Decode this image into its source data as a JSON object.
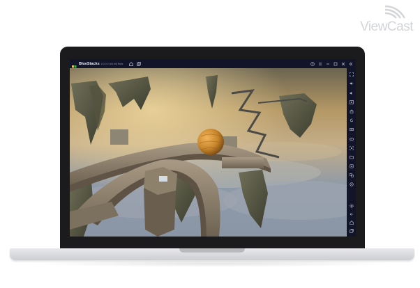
{
  "watermark": {
    "text": "ViewCast"
  },
  "titlebar": {
    "app_name": "BlueStacks",
    "version": "5.0.0.0 (64-bit) Beta",
    "left_icons": [
      "home-icon",
      "multi-instance-icon"
    ],
    "right_icons": [
      "help-icon",
      "menu-icon",
      "minimize-icon",
      "maximize-icon",
      "close-icon",
      "collapse-sidebar-icon"
    ]
  },
  "sidebar": {
    "top_icons": [
      "fullscreen-icon",
      "volume-up-icon",
      "volume-down-icon",
      "video-icon",
      "lock-cursor-icon",
      "rotate-icon",
      "keyboard-controls-icon",
      "gamepad-icon",
      "screenshot-icon",
      "folder-icon",
      "install-apk-icon",
      "multi-instance-sync-icon",
      "location-icon"
    ],
    "bottom_icons": [
      "settings-icon",
      "back-icon",
      "home-icon",
      "recent-apps-icon"
    ]
  },
  "colors": {
    "bluestacks_bar": "#12152a",
    "icon": "#c9cce0",
    "ball": "#c8862a"
  }
}
